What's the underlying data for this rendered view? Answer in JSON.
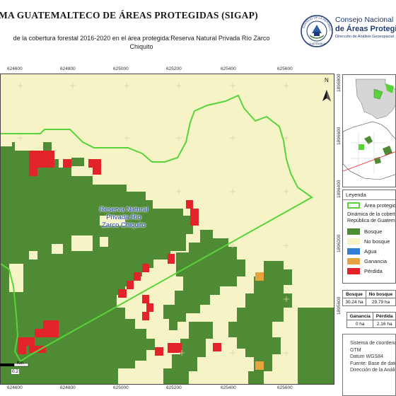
{
  "header": {
    "title": "MA GUATEMALTECO DE ÁREAS PROTEGIDAS  (SIGAP)",
    "subtitle_line1": "de la cobertura forestal 2016-2020 en el área protegida:Reserva Natural Privada Río Zarco",
    "subtitle_line2": "Chiquito"
  },
  "org": {
    "line1": "Consejo Nacional",
    "line2": "de Áreas Protegidas",
    "line3": "Dirección de Análisis Geoespacial",
    "seal_text_top": "CONSEJO DE LA REPÚBLICA",
    "seal_text_bottom": "GUATEMALA"
  },
  "map": {
    "x_ticks": [
      "624600",
      "624800",
      "625000",
      "625200",
      "625400",
      "625600"
    ],
    "y_ticks": [
      "1896800",
      "1896600",
      "1896400",
      "1896200",
      "1896000",
      "1895800",
      "1895600"
    ],
    "label": [
      "Reserva Natural",
      "Privada Río",
      "Zarco Chiquito"
    ],
    "north": "N",
    "scale_label": "Km",
    "scale_value": "0.2",
    "colors": {
      "bosque": "#4f8a34",
      "no_bosque": "#f6f3c7",
      "perdida": "#e2232a",
      "ganancia": "#e8a43c",
      "agua": "#2f7fd6",
      "boundary": "#58d43a"
    }
  },
  "legend": {
    "header": "Leyenda",
    "area": "Área protegida",
    "dyn_line1": "Dinámica de la cobertura",
    "dyn_line2": "República de Guatemala",
    "items": [
      {
        "label": "Bosque",
        "color": "#4f8a34"
      },
      {
        "label": "No bosque",
        "color": "#f6f3c7"
      },
      {
        "label": "Agua",
        "color": "#2f7fd6"
      },
      {
        "label": "Ganancia",
        "color": "#e8a43c"
      },
      {
        "label": "Pérdida",
        "color": "#e2232a"
      }
    ]
  },
  "table1": {
    "headers": [
      "Bosque",
      "No bosque"
    ],
    "values": [
      "30.24 ha",
      "29.79 ha"
    ]
  },
  "table2": {
    "headers": [
      "Ganancia",
      "Pérdida"
    ],
    "values": [
      "0 ha",
      "2.16 ha"
    ]
  },
  "info": {
    "lines": [
      "Sistema de coordenadas",
      "GTM",
      "Datum WGS84",
      "Fuente: Base de datos",
      "Dirección de la Análisis"
    ]
  }
}
